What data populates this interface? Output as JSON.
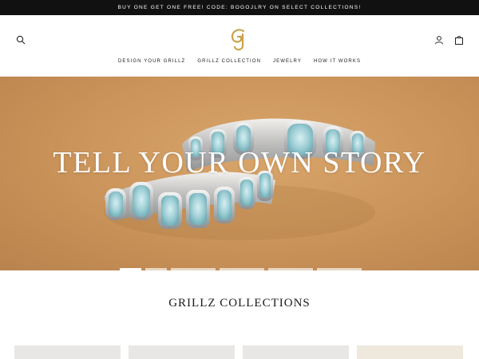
{
  "announcement": "BUY ONE GET ONE FREE! CODE: BOGOJLRY ON SELECT COLLECTIONS!",
  "header": {
    "logo_text": "GJ",
    "icons": {
      "search": "search-icon",
      "account": "user-icon",
      "cart": "bag-icon"
    },
    "account_label": "LOG IN",
    "nav": [
      "DESIGN YOUR GRILLZ",
      "GRILLZ COLLECTION",
      "JEWELRY",
      "HOW IT WORKS"
    ]
  },
  "hero": {
    "title": "TELL YOUR OWN STORY"
  },
  "collections": {
    "title": "GRILLZ COLLECTIONS"
  },
  "colors": {
    "accent_gold": "#c9a14a",
    "hero_bg": "#cf9a60",
    "announce_bg": "#111111"
  }
}
